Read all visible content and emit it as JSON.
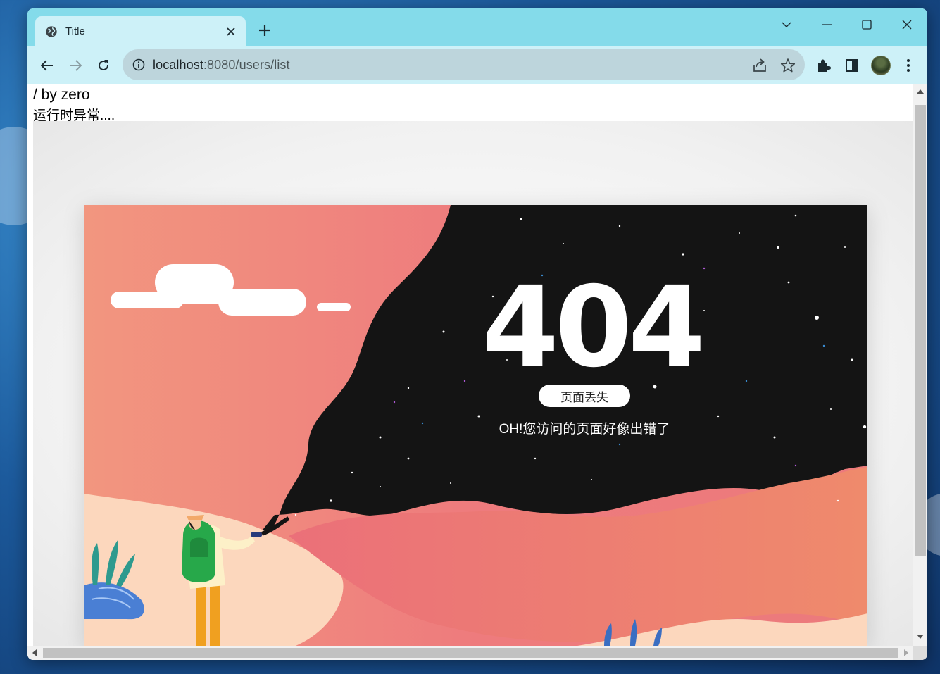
{
  "browser": {
    "tab": {
      "title": "Title",
      "favicon": "globe-icon",
      "close": "close-icon"
    },
    "new_tab_icon": "plus-icon",
    "window_controls": [
      "chevron-down-icon",
      "minimize-icon",
      "maximize-icon",
      "close-icon"
    ],
    "nav": {
      "back": "arrow-left-icon",
      "forward": "arrow-right-icon",
      "reload": "reload-icon"
    },
    "address": {
      "host": "localhost",
      "rest": ":8080/users/list"
    },
    "omnibox_icons": [
      "share-icon",
      "star-icon"
    ],
    "toolbar_icons": [
      "extensions-icon",
      "side-panel-icon",
      "avatar",
      "more-icon"
    ],
    "colors": {
      "titlebar": "#84dbea",
      "toolbar": "#cdf1f8",
      "omnibox": "#bdd5dc"
    }
  },
  "page": {
    "error_message": "/ by zero",
    "error_desc": "运行时异常....",
    "art": {
      "code": "404",
      "pill_label": "页面丢失",
      "subtitle": "OH!您访问的页面好像出错了",
      "colors": {
        "coral": "#ee7a7a",
        "night": "#141414",
        "sand": "#fcd7bd"
      }
    }
  }
}
